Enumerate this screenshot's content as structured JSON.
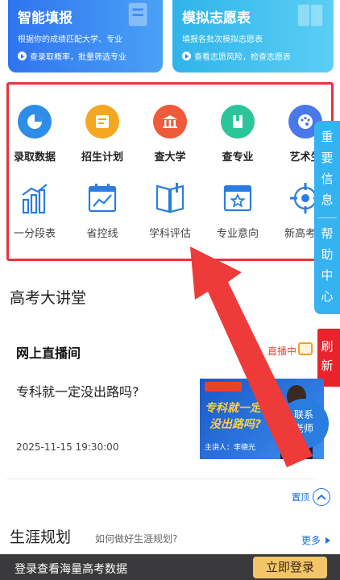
{
  "top_cards": {
    "left": {
      "title": "智能填报",
      "desc": "根据你的成绩匹配大学、专业",
      "action": "查录取概率，批量筛选专业"
    },
    "right": {
      "title": "模拟志愿表",
      "desc": "填报各批次模拟志愿表",
      "action": "查看志愿风险，检查志愿表"
    }
  },
  "grid": {
    "row1": [
      {
        "label": "录取数据",
        "icon": "pie-chart-icon",
        "color": "#2e8de8"
      },
      {
        "label": "招生计划",
        "icon": "notepad-icon",
        "color": "#f5a623"
      },
      {
        "label": "查大学",
        "icon": "university-icon",
        "color": "#ee5a3a"
      },
      {
        "label": "查专业",
        "icon": "book-icon",
        "color": "#2bc59a"
      },
      {
        "label": "艺术生",
        "icon": "palette-icon",
        "color": "#4a78e8"
      }
    ],
    "row2": [
      {
        "label": "一分段表",
        "icon": "bar-trend-icon"
      },
      {
        "label": "省控线",
        "icon": "line-chart-icon"
      },
      {
        "label": "学科评估",
        "icon": "open-book-icon"
      },
      {
        "label": "专业意向",
        "icon": "star-window-icon"
      },
      {
        "label": "新高考选",
        "icon": "target-icon"
      }
    ]
  },
  "side_tabs": {
    "blue": [
      "重",
      "要",
      "信",
      "息",
      "帮",
      "助",
      "中",
      "心"
    ],
    "red": [
      "刷",
      "新"
    ]
  },
  "lecture": {
    "section_title": "高考大讲堂",
    "card_title": "网上直播间",
    "live_tag": "直播中",
    "question": "专科就一定没出路吗?",
    "datetime": "2025-11-15 19:30:00",
    "poster": {
      "line1": "专科就一定",
      "line2": "没出路吗?",
      "speaker": "主讲人：李德光"
    },
    "contact": [
      "联系",
      "老师"
    ],
    "back_top": "置顶"
  },
  "career": {
    "title": "生涯规划",
    "subtitle": "如何做好生涯规划?",
    "more": "更多"
  },
  "bottom_bar": {
    "text": "登录查看海量高考数据",
    "button": "立即登录"
  }
}
